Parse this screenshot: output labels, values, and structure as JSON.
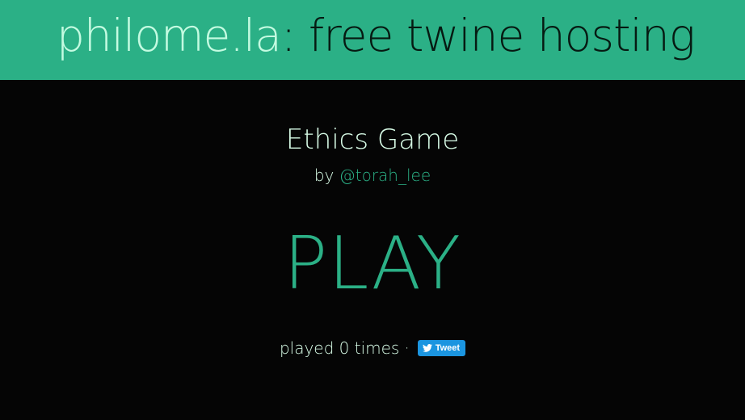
{
  "header": {
    "site_name": "philome.la",
    "tagline": ": free twine hosting"
  },
  "game": {
    "title": "Ethics Game",
    "by_label": "by",
    "author": "@torah_lee",
    "play_label": "PLAY",
    "played_text": "played 0 times",
    "separator": "·"
  },
  "tweet_button": {
    "label": "Tweet",
    "icon": "twitter-bird-icon",
    "color": "#1b95e0"
  },
  "colors": {
    "accent": "#2bb086",
    "header_link": "#c4fbe1",
    "text": "#d7fbe6",
    "background": "#050505"
  }
}
